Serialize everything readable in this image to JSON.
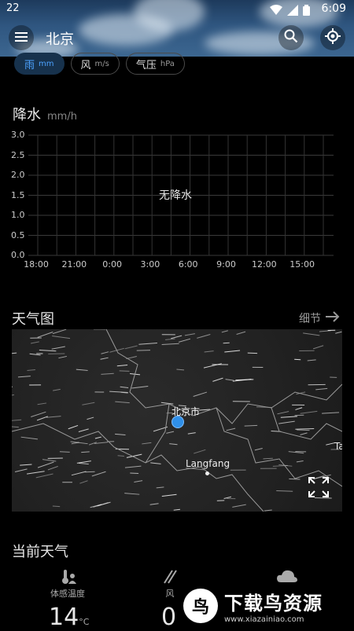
{
  "status": {
    "left": "22",
    "time": "6:09"
  },
  "header": {
    "city": "北京"
  },
  "chips": [
    {
      "label": "雨",
      "unit": "mm",
      "active": true
    },
    {
      "label": "风",
      "unit": "m/s",
      "active": false
    },
    {
      "label": "气压",
      "unit": "hPa",
      "active": false
    }
  ],
  "precip": {
    "title": "降水",
    "unit": "mm/h",
    "no_data": "无降水"
  },
  "chart_data": {
    "type": "bar",
    "title": "降水",
    "ylabel": "mm/h",
    "categories": [
      "18:00",
      "21:00",
      "0:00",
      "3:00",
      "6:00",
      "9:00",
      "12:00",
      "15:00"
    ],
    "values": [
      0,
      0,
      0,
      0,
      0,
      0,
      0,
      0
    ],
    "yticks": [
      "3.0",
      "2.5",
      "2.0",
      "1.5",
      "1.0",
      "0.5",
      "0.0"
    ],
    "ylim": [
      0,
      3.0
    ],
    "grid": true,
    "annotation": "无降水"
  },
  "map": {
    "title": "天气图",
    "detail_label": "细节",
    "city_label": "北京市",
    "place_label": "Langfang",
    "edge_label": "Ta"
  },
  "current": {
    "title": "当前天气",
    "feels_like_label": "体感温度",
    "feels_like_value": "14",
    "feels_like_unit": "°C",
    "wind_label": "风",
    "wind_value": "0"
  },
  "watermark": {
    "text": "下载鸟资源",
    "url": "www.xiazainiao.com"
  },
  "colors": {
    "accent": "#2f8fe8",
    "chip_active_bg": "#17324d",
    "chip_active_text": "#4da3ff"
  }
}
